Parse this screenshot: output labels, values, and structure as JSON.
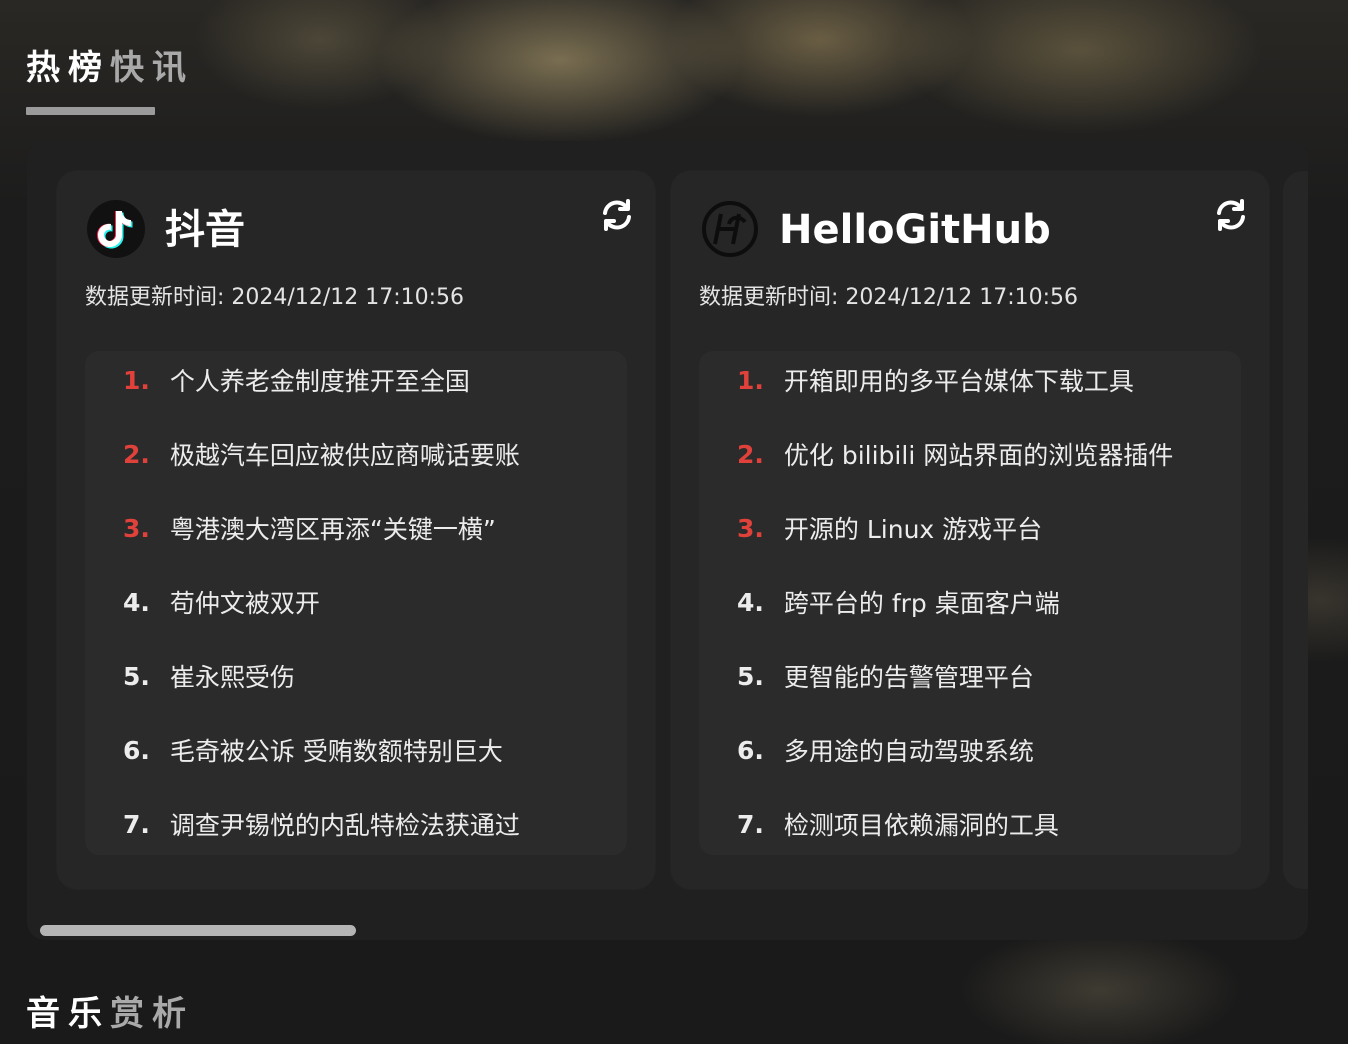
{
  "sections": {
    "hot": {
      "title_strong": "热榜",
      "title_soft": "快讯"
    },
    "music": {
      "title_strong": "音乐",
      "title_soft": "赏析"
    }
  },
  "cards": [
    {
      "name": "抖音",
      "icon": "tiktok-icon",
      "update_label": "数据更新时间:",
      "update_time": "2024/12/12 17:10:56",
      "items": [
        {
          "num": "1.",
          "text": "个人养老金制度推开至全国"
        },
        {
          "num": "2.",
          "text": "极越汽车回应被供应商喊话要账"
        },
        {
          "num": "3.",
          "text": "粤港澳大湾区再添“关键一横”"
        },
        {
          "num": "4.",
          "text": "苟仲文被双开"
        },
        {
          "num": "5.",
          "text": "崔永熙受伤"
        },
        {
          "num": "6.",
          "text": "毛奇被公诉 受贿数额特别巨大"
        },
        {
          "num": "7.",
          "text": "调查尹锡悦的内乱特检法获通过"
        }
      ]
    },
    {
      "name": "HelloGitHub",
      "icon": "hellogithub-icon",
      "update_label": "数据更新时间:",
      "update_time": "2024/12/12 17:10:56",
      "items": [
        {
          "num": "1.",
          "text": "开箱即用的多平台媒体下载工具"
        },
        {
          "num": "2.",
          "text": "优化 bilibili 网站界面的浏览器插件"
        },
        {
          "num": "3.",
          "text": "开源的 Linux 游戏平台"
        },
        {
          "num": "4.",
          "text": "跨平台的 frp 桌面客户端"
        },
        {
          "num": "5.",
          "text": "更智能的告警管理平台"
        },
        {
          "num": "6.",
          "text": "多用途的自动驾驶系统"
        },
        {
          "num": "7.",
          "text": "检测项目依赖漏洞的工具"
        }
      ]
    }
  ],
  "colors": {
    "rank_top": "#e0413a",
    "rank_normal": "#ececec",
    "card_bg": "#262626",
    "list_bg": "#2b2b2b"
  }
}
